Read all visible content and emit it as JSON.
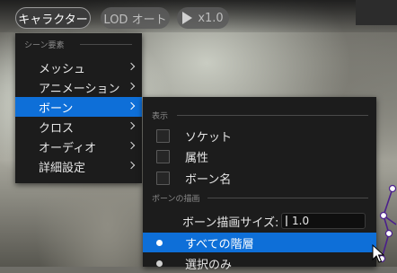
{
  "toolbar": {
    "character_label": "キャラクター",
    "lod_label": "LOD オート",
    "play_speed_label": "x1.0"
  },
  "main_menu": {
    "section_title": "シーン要素",
    "items": [
      {
        "label": "メッシュ",
        "has_submenu": true,
        "selected": false
      },
      {
        "label": "アニメーション",
        "has_submenu": true,
        "selected": false
      },
      {
        "label": "ボーン",
        "has_submenu": true,
        "selected": true
      },
      {
        "label": "クロス",
        "has_submenu": true,
        "selected": false
      },
      {
        "label": "オーディオ",
        "has_submenu": true,
        "selected": false
      },
      {
        "label": "詳細設定",
        "has_submenu": true,
        "selected": false
      }
    ]
  },
  "bone_menu": {
    "display_section": "表示",
    "checks": [
      {
        "label": "ソケット",
        "checked": false
      },
      {
        "label": "属性",
        "checked": false
      },
      {
        "label": "ボーン名",
        "checked": false
      }
    ],
    "draw_section": "ボーンの描画",
    "size_label": "ボーン描画サイズ:",
    "size_value": "1.0",
    "radios": [
      {
        "label": "すべての階層",
        "selected": true
      },
      {
        "label": "選択のみ",
        "selected": false
      }
    ]
  },
  "colors": {
    "accent": "#0e6fd8",
    "menu_bg": "#1c1c1c"
  }
}
